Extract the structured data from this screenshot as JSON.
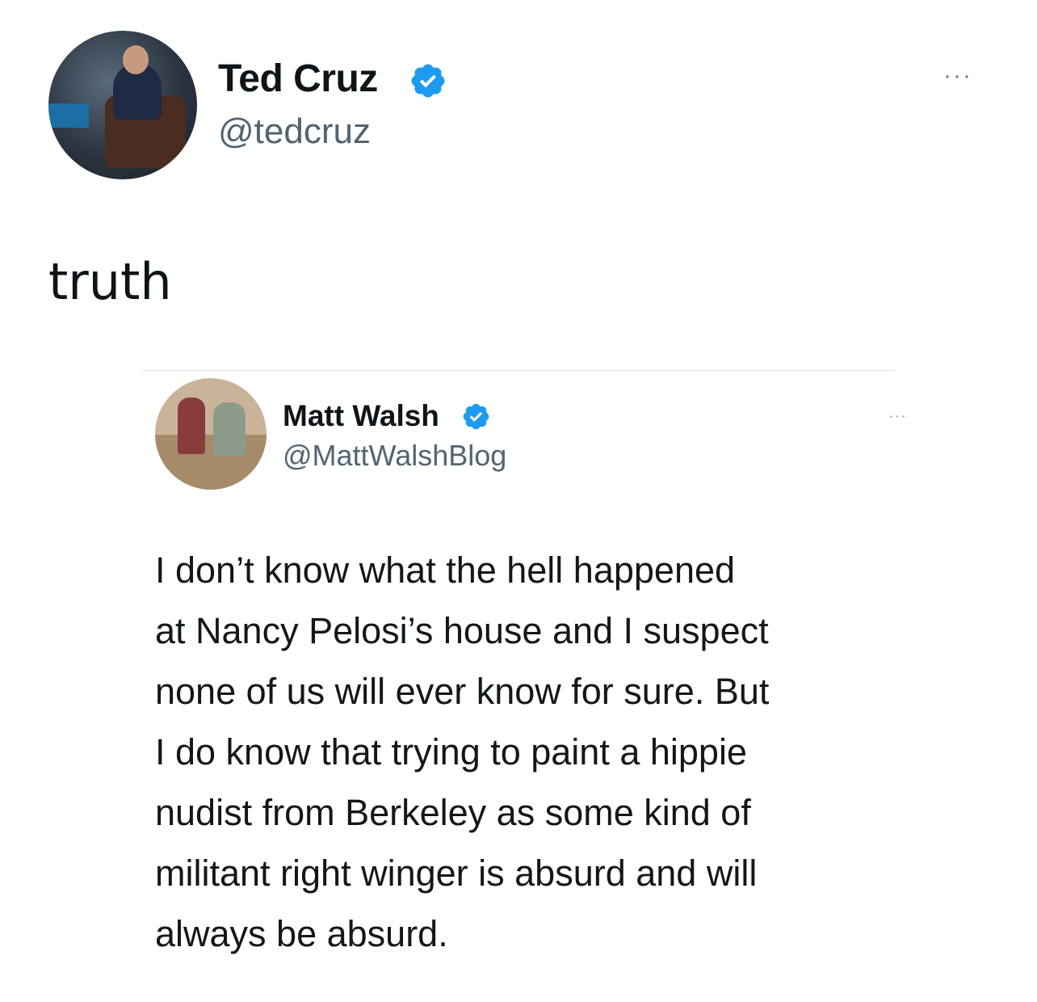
{
  "tweet": {
    "author_name": "Ted Cruz",
    "author_handle": "@tedcruz",
    "text": "truth",
    "more_label": "···"
  },
  "quoted": {
    "author_name": "Matt Walsh",
    "author_handle": "@MattWalshBlog",
    "more_label": "···",
    "lines": [
      "I don’t know what the hell happened",
      "at Nancy Pelosi’s house and I suspect",
      "none of us will ever know for sure. But",
      "I do know that trying to paint a hippie",
      "nudist from Berkeley as some kind of",
      "militant right winger is absurd and will",
      "always be absurd."
    ]
  },
  "colors": {
    "verified": "#1d9bf0",
    "handle": "#536471",
    "text": "#0f1419"
  },
  "icons": {
    "verified": "verified-badge-icon",
    "more": "more-options-icon"
  }
}
